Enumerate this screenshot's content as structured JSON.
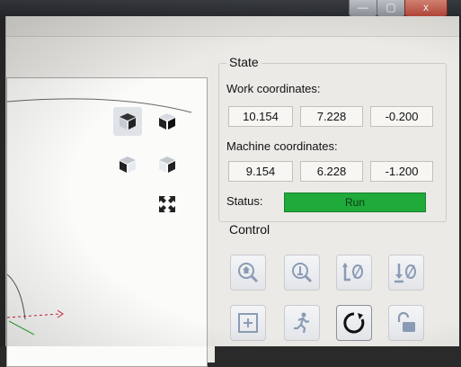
{
  "window": {
    "controls": {
      "minimize": "—",
      "maximize": "▢",
      "close": "x"
    }
  },
  "viewport": {
    "buttons": [
      {
        "name": "view-iso-front-icon"
      },
      {
        "name": "view-iso-top-icon"
      },
      {
        "name": "view-iso-left-icon"
      },
      {
        "name": "view-iso-right-icon"
      },
      {
        "name": "fit-view-icon"
      }
    ]
  },
  "state": {
    "title": "State",
    "work_label": "Work coordinates:",
    "work": [
      "10.154",
      "7.228",
      "-0.200"
    ],
    "machine_label": "Machine coordinates:",
    "machine": [
      "9.154",
      "6.228",
      "-1.200"
    ],
    "status_label": "Status:",
    "status_value": "Run",
    "status_color": "#1faa3a"
  },
  "control": {
    "title": "Control",
    "buttons": [
      {
        "icon": "home-search-icon",
        "label": "Home"
      },
      {
        "icon": "probe-z-icon",
        "label": "Probe"
      },
      {
        "icon": "zero-xy-icon",
        "label": "Zero XY"
      },
      {
        "icon": "zero-z-icon",
        "label": "Zero Z"
      },
      {
        "icon": "restore-origin-icon",
        "label": "Restore origin"
      },
      {
        "icon": "jog-run-icon",
        "label": "Jog"
      },
      {
        "icon": "reset-icon",
        "label": "Reset"
      },
      {
        "icon": "unlock-icon",
        "label": "Unlock"
      }
    ]
  }
}
